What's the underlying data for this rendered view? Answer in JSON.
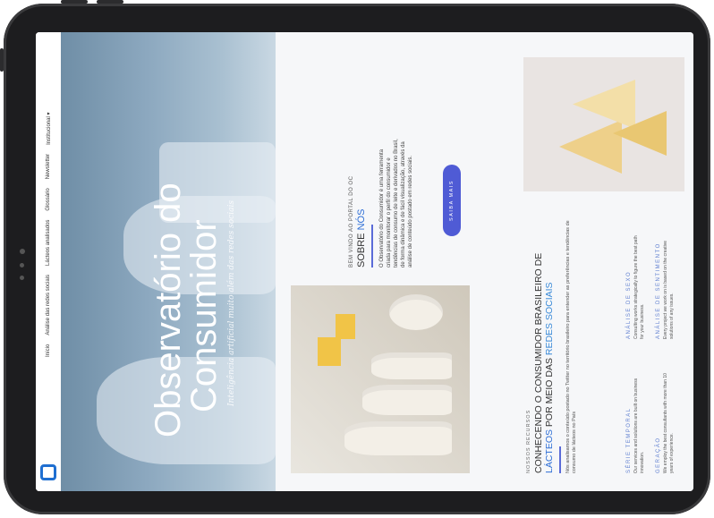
{
  "nav": {
    "items": [
      "Início",
      "Análise das redes sociais",
      "Lácteos analisados",
      "Glossário",
      "Newsletter",
      "Institucional ▾"
    ]
  },
  "hero": {
    "title_line1": "Observatório do",
    "title_line2": "Consumidor",
    "subtitle": "Inteligência artificial muito além das redes sociais"
  },
  "welcome": {
    "eyebrow": "BEM VINDO AO PORTAL DO OC",
    "title_prefix": "SOBRE",
    "title_accent": "NÓS",
    "text": "O Observatório do Consumidor é uma ferramenta criada para monitorar o perfil do consumidor e tendências de consumo de leite e derivados no Brasil, de forma dinâmica e de fácil visualização, através da análise de conteúdo postado em redes sociais.",
    "button": "SAIBA MAIS"
  },
  "resources": {
    "eyebrow": "NOSSOS RECURSOS",
    "title_line1": "CONHECENDO O CONSUMIDOR BRASILEIRO DE",
    "title_blue1": "LÁCTEOS",
    "title_mid": " POR MEIO DAS ",
    "title_blue2": "REDES SOCIAIS",
    "text": "Nós analisamos o conteúdo postado no Twitter no território brasileiro para entender as preferências e tendências de consumo de lácteos no País",
    "features": [
      {
        "title": "SÉRIE TEMPORAL",
        "text": "Our services and solutions are built on business innovation."
      },
      {
        "title": "ANÁLISE DE SEXO",
        "text": "Consulting works strategically to figure the best path for your business."
      },
      {
        "title": "GERAÇÃO",
        "text": "We employ the best consultants with more than 10 years of experience."
      },
      {
        "title": "ANÁLISE DE SENTIMENTO",
        "text": "Every project we work on is based on the creative solutions of any issues."
      }
    ]
  },
  "colors": {
    "accent": "#2f6fd6",
    "button": "#4f5bd5",
    "frame": "#1d1d1f"
  },
  "icons": {
    "logo": "square-logo-icon",
    "camera": "camera-dot-icon"
  }
}
